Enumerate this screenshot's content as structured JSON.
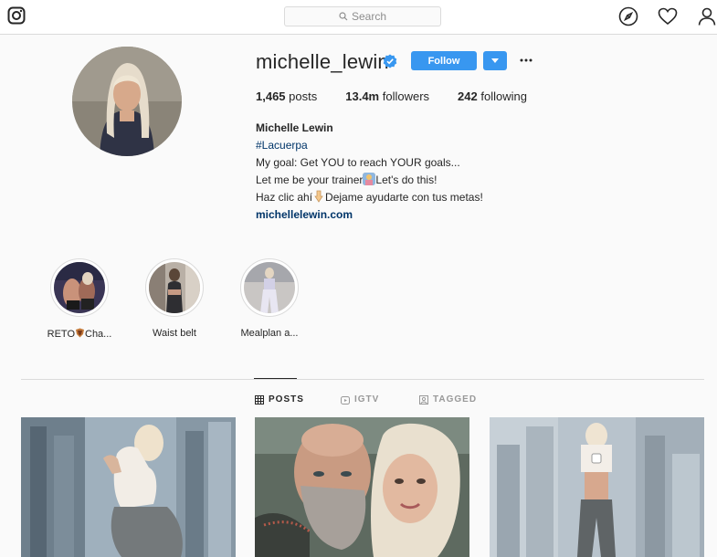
{
  "nav": {
    "search_placeholder": "Search",
    "icons": [
      "instagram-logo-icon",
      "explore-compass-icon",
      "activity-heart-icon",
      "profile-person-icon"
    ]
  },
  "profile": {
    "username": "michelle_lewin",
    "verified": true,
    "follow_label": "Follow",
    "stats": {
      "posts_count": "1,465",
      "posts_label": "posts",
      "followers_count": "13.4m",
      "followers_label": "followers",
      "following_count": "242",
      "following_label": "following"
    },
    "bio": {
      "full_name": "Michelle Lewin",
      "hashtag": "#Lacuerpa",
      "line1": "My goal: Get YOU to reach YOUR goals...",
      "line2a": "Let me be your trainer",
      "line2b": "Let's do this!",
      "line3a": "Haz clic ahí",
      "line3b": "Dejame ayudarte con tus metas!",
      "website": "michellelewin.com"
    }
  },
  "highlights": [
    {
      "label_a": "RETO",
      "label_b": "Cha..."
    },
    {
      "label": "Waist belt"
    },
    {
      "label": "Mealplan a..."
    }
  ],
  "tabs": [
    {
      "label": "POSTS",
      "active": true
    },
    {
      "label": "IGTV",
      "active": false
    },
    {
      "label": "TAGGED",
      "active": false
    }
  ],
  "colors": {
    "accent": "#3897f0",
    "link": "#003569",
    "border": "#dbdbdb",
    "background": "#fafafa"
  }
}
